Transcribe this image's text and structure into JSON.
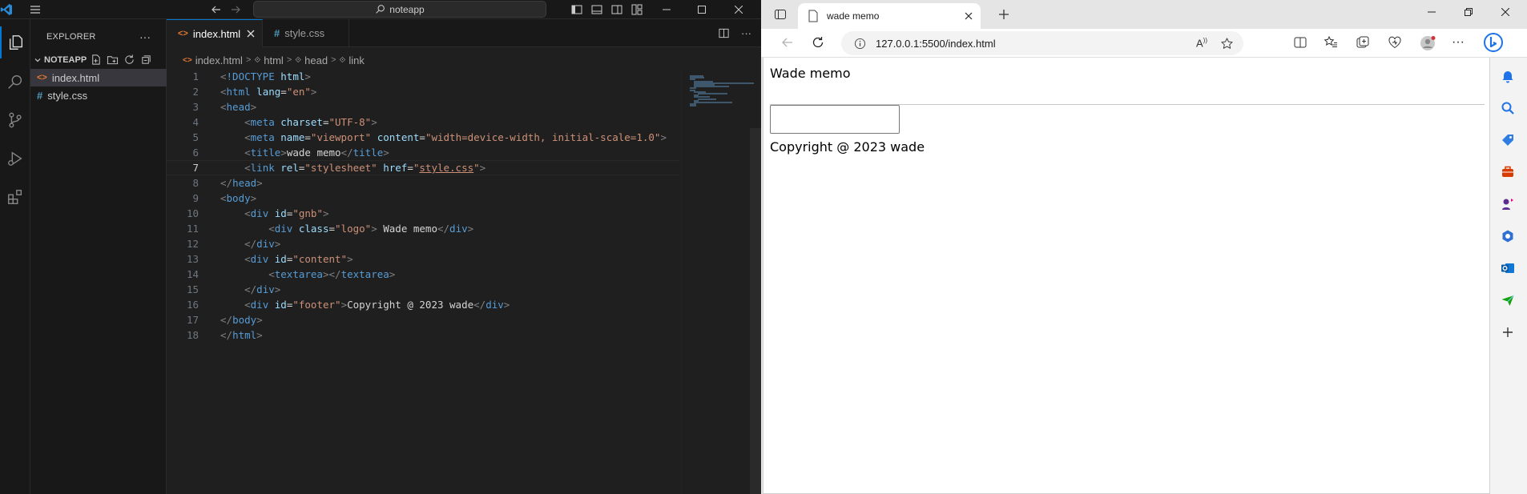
{
  "vscode": {
    "search_text": "noteapp",
    "explorer_title": "EXPLORER",
    "folder_name": "NOTEAPP",
    "files": [
      {
        "name": "index.html",
        "icon": "html-file-icon",
        "selected": true
      },
      {
        "name": "style.css",
        "icon": "css-file-icon",
        "selected": false
      }
    ],
    "tabs": [
      {
        "label": "index.html",
        "active": true
      },
      {
        "label": "style.css",
        "active": false
      }
    ],
    "breadcrumb": [
      "index.html",
      "html",
      "head",
      "link"
    ],
    "line_numbers": [
      "1",
      "2",
      "3",
      "4",
      "5",
      "6",
      "7",
      "8",
      "9",
      "10",
      "11",
      "12",
      "13",
      "14",
      "15",
      "16",
      "17",
      "18"
    ],
    "current_line": 7,
    "code_lines": [
      "<!DOCTYPE html>",
      "<html lang=\"en\">",
      "<head>",
      "    <meta charset=\"UTF-8\">",
      "    <meta name=\"viewport\" content=\"width=device-width, initial-scale=1.0\">",
      "    <title>wade memo</title>",
      "    <link rel=\"stylesheet\" href=\"style.css\">",
      "</head>",
      "<body>",
      "    <div id=\"gnb\">",
      "        <div class=\"logo\"> Wade memo</div>",
      "    </div>",
      "    <div id=\"content\">",
      "        <textarea></textarea>",
      "    </div>",
      "    <div id=\"footer\">Copyright @ 2023 wade</div>",
      "</body>",
      "</html>"
    ]
  },
  "browser": {
    "tab_title": "wade memo",
    "url": "127.0.0.1:5500/index.html",
    "page": {
      "logo": "Wade memo",
      "textarea_value": "",
      "footer": "Copyright @ 2023 wade"
    }
  },
  "colors": {
    "vscode_bg": "#1f1f1f",
    "vscode_accent": "#0078d4",
    "html_tag": "#569cd6",
    "html_attr": "#9cdcfe",
    "html_string": "#ce9178",
    "browser_chrome": "#e5e5e5"
  }
}
